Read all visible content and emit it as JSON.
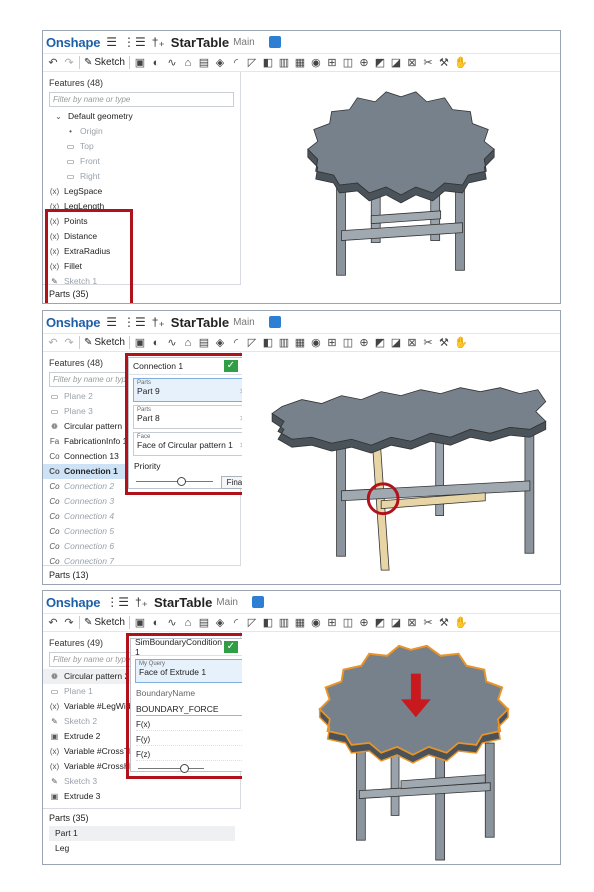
{
  "app": {
    "logo": "Onshape",
    "doc_title": "StarTable",
    "workspace": "Main",
    "sketch_label": "Sketch"
  },
  "panel1": {
    "features_header": "Features (48)",
    "filter_placeholder": "Filter by name or type",
    "items": [
      "Default geometry",
      "Origin",
      "Top",
      "Front",
      "Right",
      "LegSpace",
      "LegLength",
      "Points",
      "Distance",
      "ExtraRadius",
      "Fillet",
      "Sketch 1"
    ],
    "var_prefix": "(x)",
    "parts_header": "Parts (35)"
  },
  "panel2": {
    "features_header": "Features (48)",
    "filter_placeholder": "Filter by name or type",
    "items": [
      "Plane 2",
      "Plane 3",
      "Circular pattern 1",
      "FabricationInfo 1",
      "Connection 13",
      "Connection 1",
      "Connection 2",
      "Connection 3",
      "Connection 4",
      "Connection 5",
      "Connection 6",
      "Connection 7"
    ],
    "parts_header": "Parts (13)",
    "dialog": {
      "title": "Connection 1",
      "f1_label": "Parts",
      "f1_value": "Part 9",
      "f2_label": "Parts",
      "f2_value": "Part 8",
      "f3_label": "Face",
      "f3_value": "Face of Circular pattern 1",
      "priority_label": "Priority",
      "priority_value": "1",
      "final_button": "Final",
      "slider_level": 0.6
    }
  },
  "panel3": {
    "features_header": "Features (49)",
    "filter_placeholder": "Filter by name or type",
    "items": [
      "Circular pattern 2",
      "Plane 1",
      "Variable #LegWidth",
      "Sketch 2",
      "Extrude 2",
      "Variable #CrossTh",
      "Variable #CrossHe",
      "Sketch 3",
      "Extrude 3"
    ],
    "parts_header": "Parts (35)",
    "parts": [
      "Part 1",
      "Leg"
    ],
    "dialog": {
      "title": "SimBoundaryCondition 1",
      "query_label": "My Query",
      "query_value": "Face of Extrude 1",
      "bn_label": "BoundaryName",
      "bn_value": "BOUNDARY_FORCE",
      "fx_label": "F(x)",
      "fx_value": "0",
      "fy_label": "F(y)",
      "fy_value": "0",
      "fz_label": "F(z)",
      "fz_value": "-1",
      "slider_level": 0.7
    }
  },
  "colors": {
    "accent": "#1f5fa8",
    "highlight": "#b0121b",
    "table": "#7d8791",
    "leg_hl": "#e8d5a6"
  }
}
